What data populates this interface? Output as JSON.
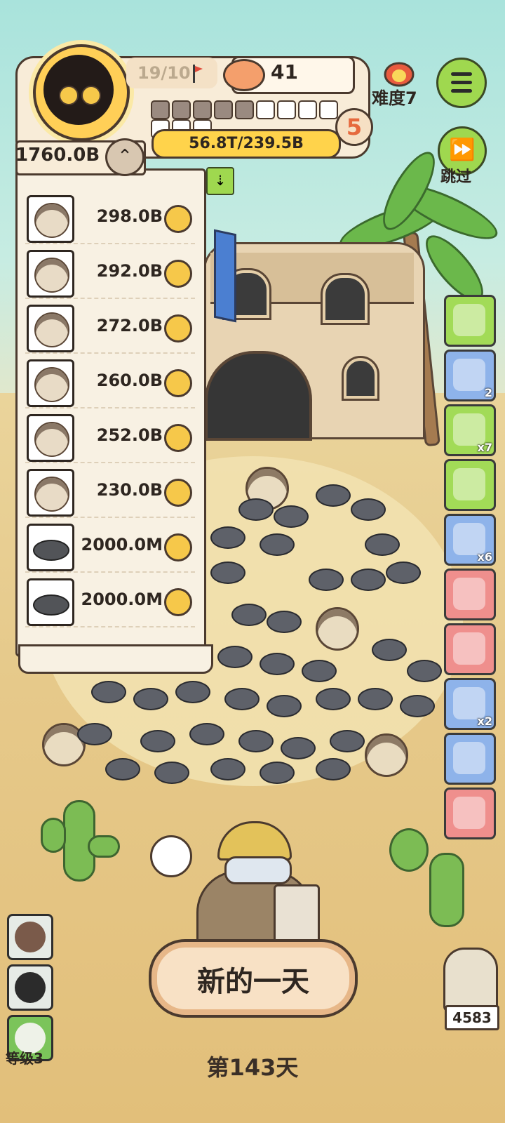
{
  "header": {
    "stamp_count": "19/10",
    "bowl_count": "41",
    "level": "5",
    "money": "56.8T/239.5B",
    "progress_filled": 5,
    "progress_total": 12,
    "difficulty": "难度7",
    "skip_label": "跳过"
  },
  "list": {
    "total": "1760.0B",
    "rows": [
      {
        "type": "hedgehog",
        "value": "298.0B"
      },
      {
        "type": "hedgehog",
        "value": "292.0B"
      },
      {
        "type": "hedgehog",
        "value": "272.0B"
      },
      {
        "type": "hedgehog",
        "value": "260.0B"
      },
      {
        "type": "hedgehog",
        "value": "252.0B"
      },
      {
        "type": "hedgehog",
        "value": "230.0B"
      },
      {
        "type": "mole",
        "value": "2000.0M"
      },
      {
        "type": "mole",
        "value": "2000.0M"
      }
    ]
  },
  "items": [
    {
      "icon": "card-icon",
      "color": "green",
      "mult": ""
    },
    {
      "icon": "shovel-hourglass-icon",
      "color": "blue",
      "mult": "2"
    },
    {
      "icon": "helmet-icon",
      "color": "green",
      "mult": "x7"
    },
    {
      "icon": "ticket-icon",
      "color": "green",
      "mult": ""
    },
    {
      "icon": "bread-icon",
      "color": "blue",
      "mult": "x6"
    },
    {
      "icon": "magic-staff-icon",
      "color": "pink",
      "mult": ""
    },
    {
      "icon": "feather-icon",
      "color": "pink",
      "mult": ""
    },
    {
      "icon": "grain-sack-icon",
      "color": "blue",
      "mult": "x2"
    },
    {
      "icon": "crate-icon",
      "color": "blue",
      "mult": ""
    },
    {
      "icon": "heart-creature-icon",
      "color": "pink",
      "mult": ""
    }
  ],
  "bottom": {
    "new_day_label": "新的一天",
    "day_label": "第143天",
    "level_label": "等级3",
    "owl_count": "4583"
  },
  "colors": {
    "green": "#a2db57",
    "blue": "#8eb3ea",
    "pink": "#ef8f8d",
    "accent_yellow": "#ffd34b",
    "level_orange": "#e6693d"
  }
}
